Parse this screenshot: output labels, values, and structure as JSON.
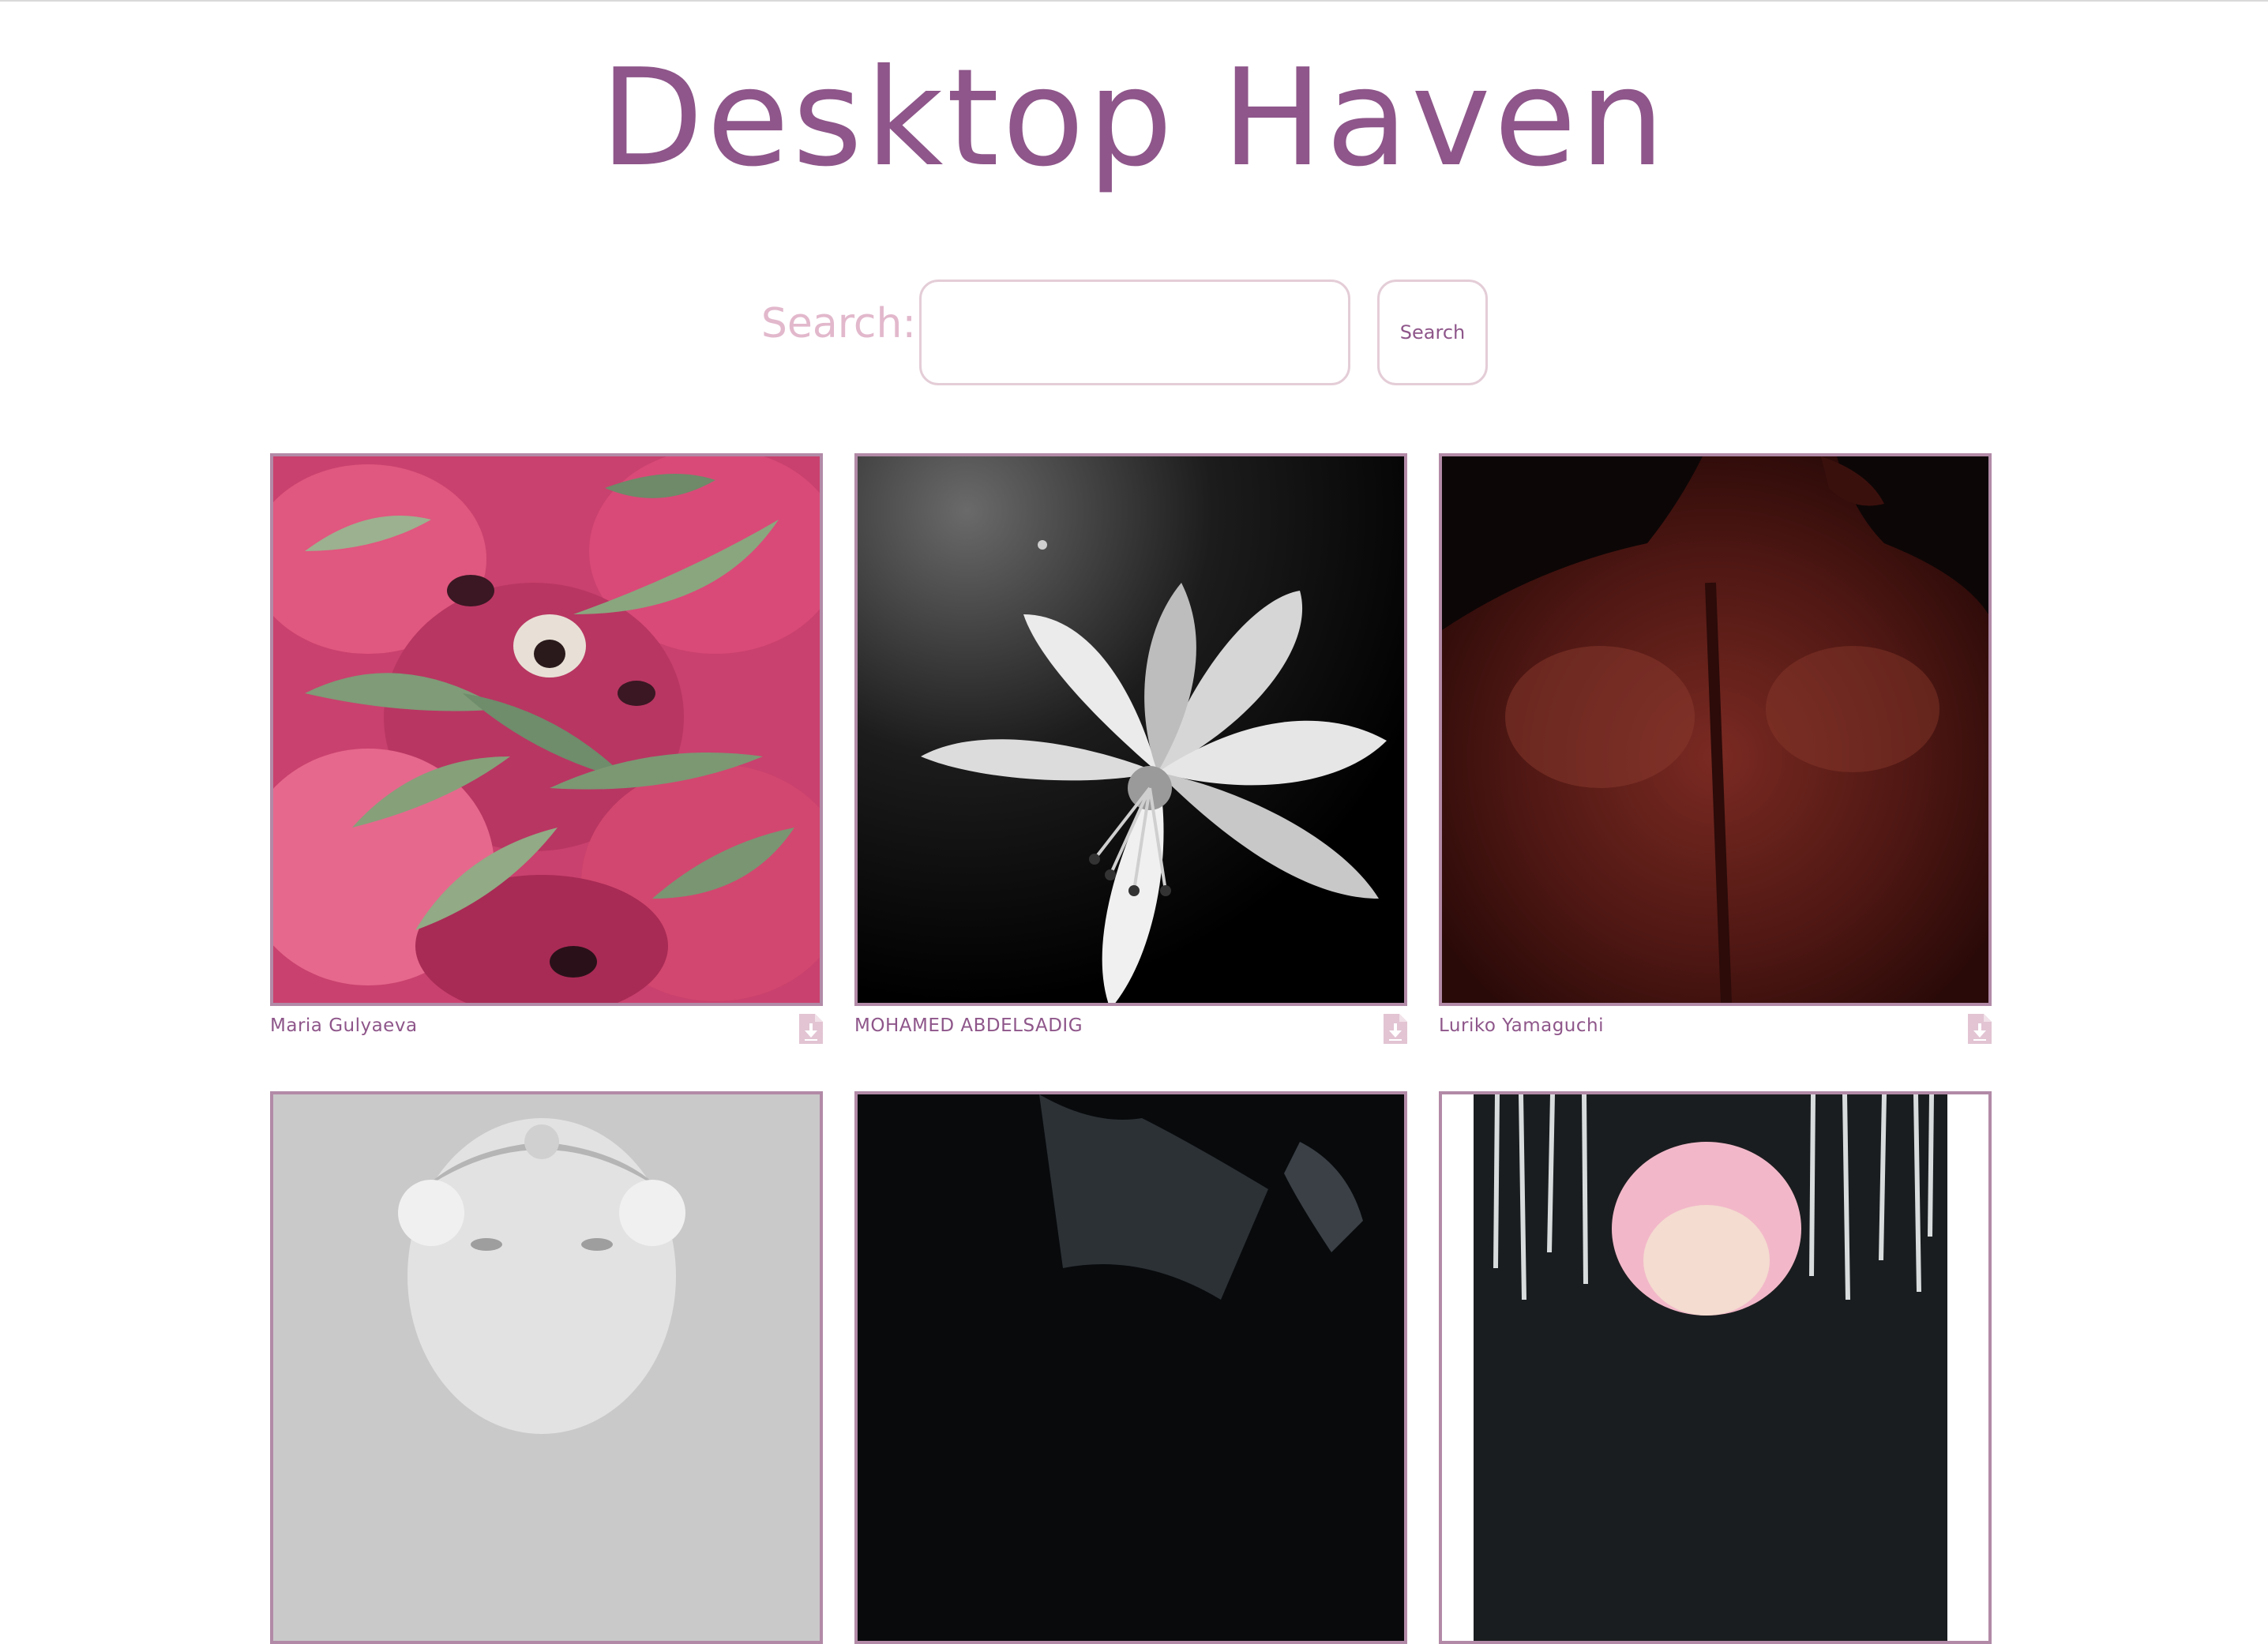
{
  "site": {
    "title": "Desktop Haven"
  },
  "search": {
    "label": "Search:",
    "input_value": "",
    "placeholder": "",
    "button_label": "Search"
  },
  "gallery": {
    "items": [
      {
        "author": "Maria Gulyaeva",
        "icon": "download-icon"
      },
      {
        "author": "MOHAMED ABDELSADIG",
        "icon": "download-icon"
      },
      {
        "author": "Luriko Yamaguchi",
        "icon": "download-icon"
      }
    ]
  },
  "colors": {
    "accent": "#8e568a",
    "label": "#e2b8cc",
    "border": "#b28aa7",
    "icon": "#e2c4d3"
  }
}
